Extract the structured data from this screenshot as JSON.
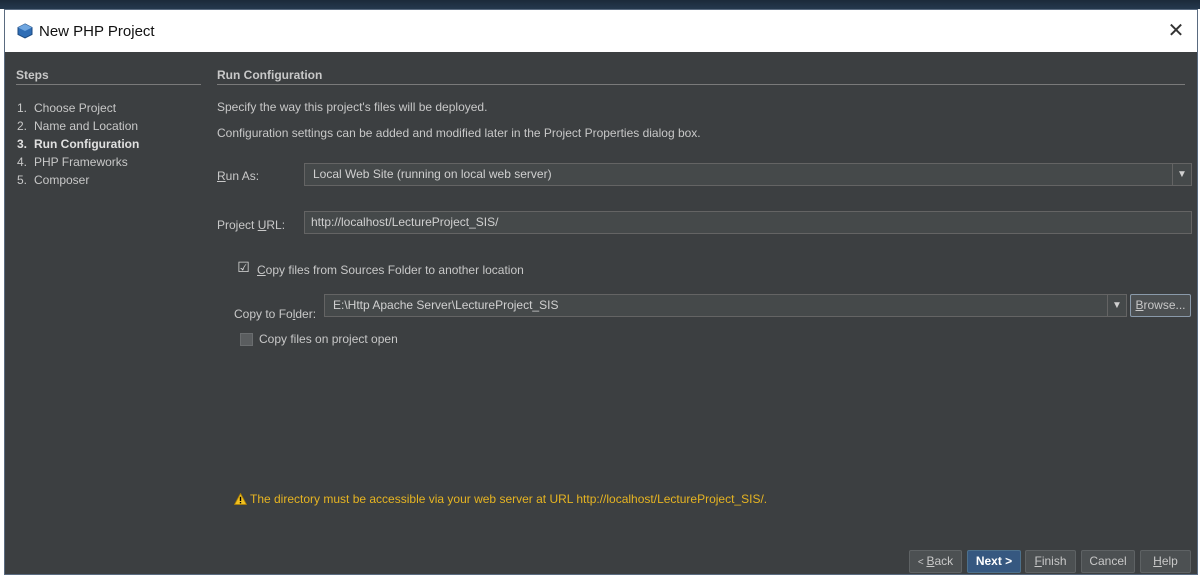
{
  "window": {
    "title": "New PHP Project",
    "close_symbol": "✕"
  },
  "steps": {
    "title": "Steps",
    "items": [
      {
        "num": "1.",
        "label": "Choose Project"
      },
      {
        "num": "2.",
        "label": "Name and Location"
      },
      {
        "num": "3.",
        "label": "Run Configuration"
      },
      {
        "num": "4.",
        "label": "PHP Frameworks"
      },
      {
        "num": "5.",
        "label": "Composer"
      }
    ]
  },
  "main": {
    "title": "Run Configuration",
    "desc1": "Specify the way this project's files will be deployed.",
    "desc2": "Configuration settings can be added and modified later in the Project Properties dialog box.",
    "run_as": {
      "label_mnemonic": "R",
      "label_rest": "un As:",
      "value": "Local Web Site (running on local web server)"
    },
    "project_url": {
      "label_pre": "Project ",
      "label_mnemonic": "U",
      "label_post": "RL:",
      "value": "http://localhost/LectureProject_SIS/"
    },
    "copy_files": {
      "mnemonic": "C",
      "label_rest": "opy files from Sources Folder to another location",
      "checked": true
    },
    "copy_to_folder": {
      "label_pre": "Copy to Fo",
      "label_mnemonic": "l",
      "label_post": "der:",
      "value": "E:\\Http Apache Server\\LectureProject_SIS"
    },
    "browse": {
      "mnemonic": "B",
      "rest": "rowse..."
    },
    "copy_on_open": {
      "label": "Copy files on project open",
      "checked": false
    },
    "warning": "The directory must be accessible via your web server at URL http://localhost/LectureProject_SIS/."
  },
  "buttons": {
    "back": {
      "prefix": "< ",
      "mnemonic": "B",
      "rest": "ack"
    },
    "next": "Next >",
    "finish": {
      "mnemonic": "F",
      "rest": "inish"
    },
    "cancel": "Cancel",
    "help": {
      "mnemonic": "H",
      "rest": "elp"
    }
  },
  "colors": {
    "dialog_bg": "#3c3f41",
    "field_bg": "#45494a",
    "default_button": "#365880",
    "warning": "#e6b422"
  }
}
